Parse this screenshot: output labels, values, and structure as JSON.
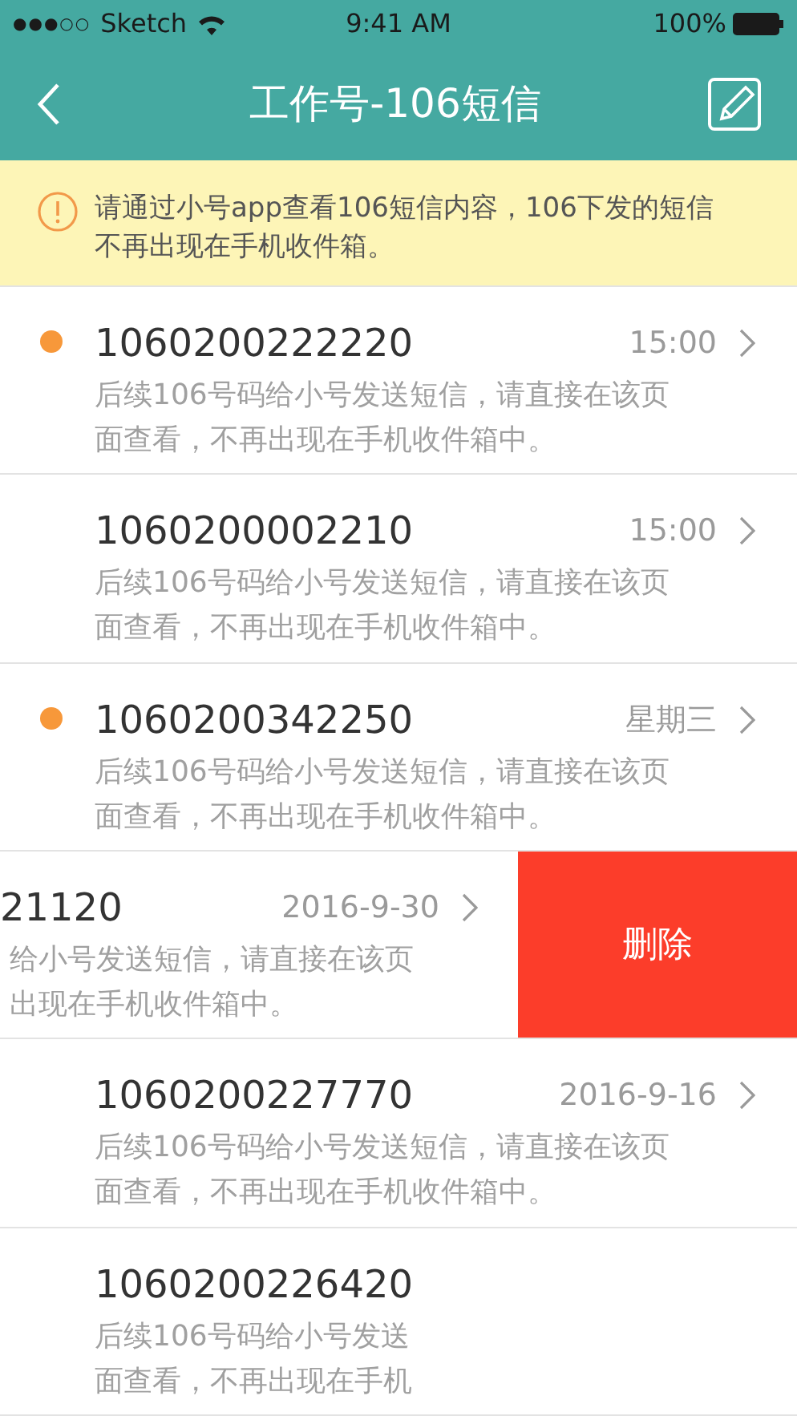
{
  "status_bar": {
    "signal": "●●●○○",
    "carrier": "Sketch",
    "time": "9:41 AM",
    "battery": "100%"
  },
  "nav": {
    "title": "工作号-106短信"
  },
  "notice": {
    "text": "请通过小号app查看106短信内容，106下发的短信不再出现在手机收件箱。"
  },
  "messages": [
    {
      "kind": "message",
      "unread": true,
      "number": "1060200222220",
      "time": "15:00",
      "preview_lines": [
        "后续106号码给小号发送短信，请直接在该页",
        "面查看，不再出现在手机收件箱中。"
      ]
    },
    {
      "kind": "message",
      "unread": false,
      "number": "1060200002210",
      "time": "15:00",
      "preview_lines": [
        "后续106号码给小号发送短信，请直接在该页",
        "面查看，不再出现在手机收件箱中。"
      ]
    },
    {
      "kind": "message",
      "unread": true,
      "number": "1060200342250",
      "time": "星期三",
      "preview_lines": [
        "后续106号码给小号发送短信，请直接在该页",
        "面查看，不再出现在手机收件箱中。"
      ]
    },
    {
      "kind": "swiped",
      "unread": false,
      "number": "21120",
      "time": "2016-9-30",
      "preview_lines": [
        "给小号发送短信，请直接在该页",
        "出现在手机收件箱中。"
      ],
      "action": "删除"
    },
    {
      "kind": "message",
      "unread": false,
      "number": "1060200227770",
      "time": "2016-9-16",
      "preview_lines": [
        "后续106号码给小号发送短信，请直接在该页",
        "面查看，不再出现在手机收件箱中。"
      ]
    },
    {
      "kind": "message",
      "unread": false,
      "number": "1060200226420",
      "preview_lines": [
        "后续106号码给小号发送",
        "面查看，不再出现在手机"
      ]
    }
  ]
}
